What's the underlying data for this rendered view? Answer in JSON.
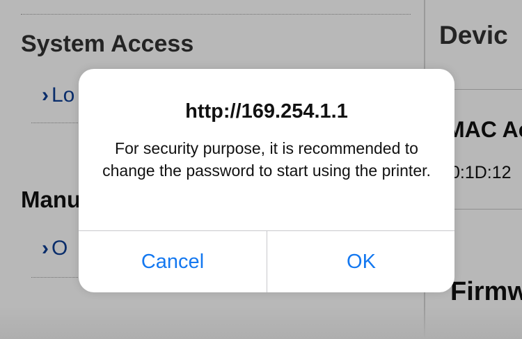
{
  "background": {
    "left": {
      "system_access_title": "System Access",
      "login_link": "Lo",
      "manual_title": "Manu",
      "other_link": "O"
    },
    "right": {
      "device_title": "Devic",
      "mac_label": "MAC Ac",
      "mac_value": "0:1D:12",
      "firmware_label": "Firmw"
    },
    "chevron": "›"
  },
  "dialog": {
    "title": "http://169.254.1.1",
    "message": "For security purpose, it is recommended to change the password to start using the printer.",
    "cancel_label": "Cancel",
    "ok_label": "OK"
  },
  "colors": {
    "link": "#0d3f95",
    "button": "#1478f0",
    "overlay": "rgba(0,0,0,0.28)"
  }
}
